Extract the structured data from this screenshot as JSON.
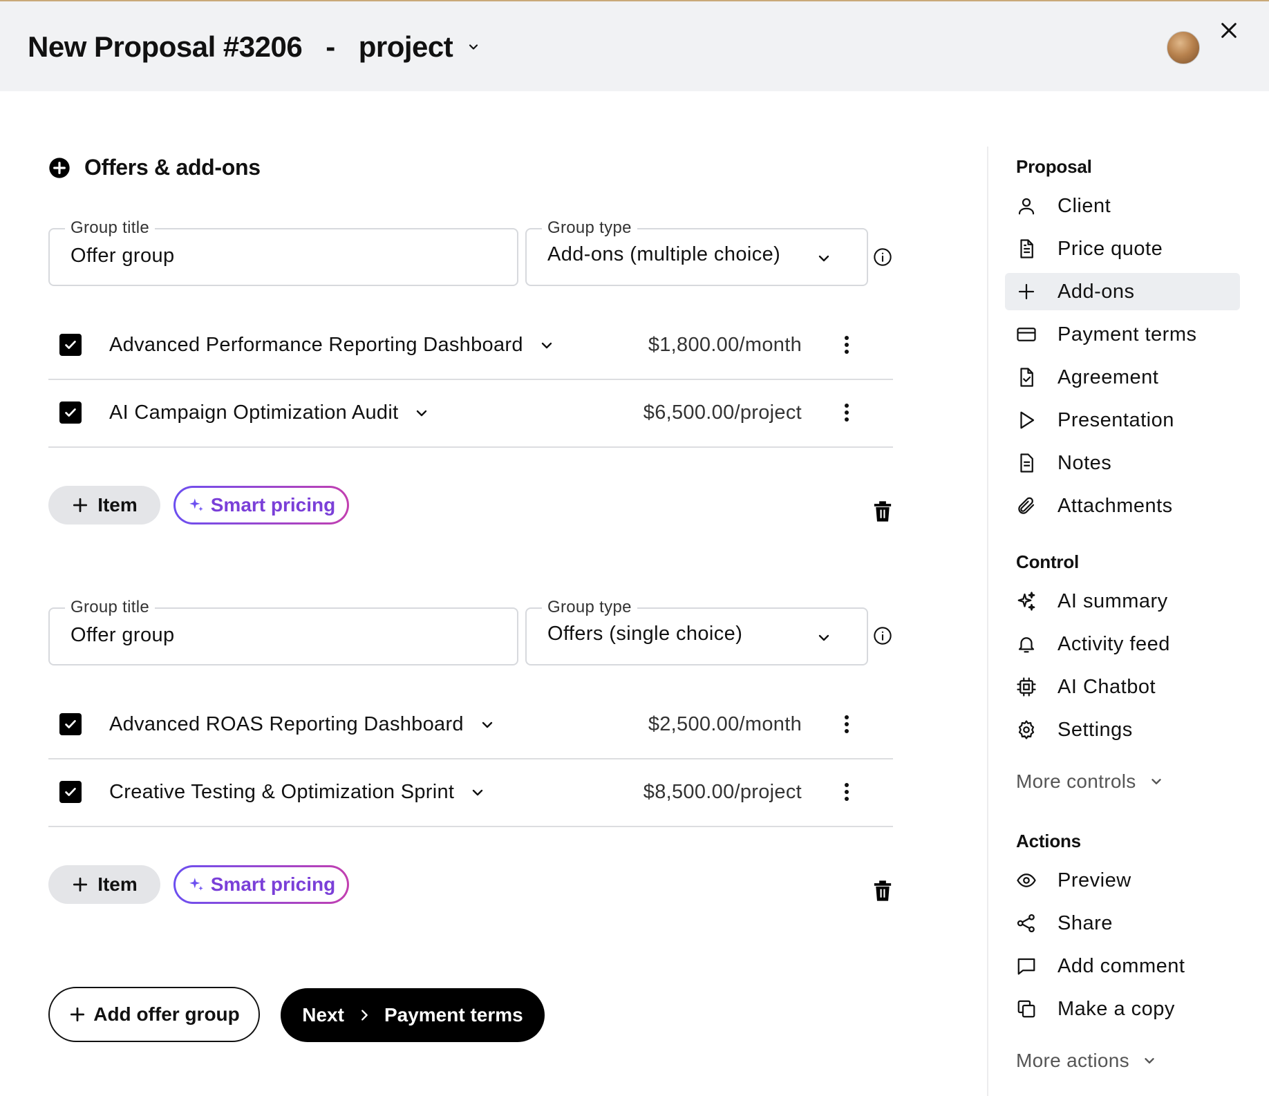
{
  "header": {
    "title": "New Proposal #3206",
    "separator": "-",
    "project": "project"
  },
  "main": {
    "section_title": "Offers & add-ons",
    "groups": [
      {
        "title_label": "Group title",
        "title_value": "Offer group",
        "type_label": "Group type",
        "type_value": "Add-ons (multiple choice)",
        "items": [
          {
            "name": "Advanced Performance Reporting Dashboard",
            "price": "$1,800.00/month",
            "checked": true
          },
          {
            "name": "AI Campaign Optimization Audit",
            "price": "$6,500.00/project",
            "checked": true
          }
        ],
        "item_button": "Item",
        "smart_pricing": "Smart pricing"
      },
      {
        "title_label": "Group title",
        "title_value": "Offer group",
        "type_label": "Group type",
        "type_value": "Offers (single choice)",
        "items": [
          {
            "name": "Advanced ROAS Reporting Dashboard",
            "price": "$2,500.00/month",
            "checked": true
          },
          {
            "name": "Creative Testing & Optimization Sprint",
            "price": "$8,500.00/project",
            "checked": true
          }
        ],
        "item_button": "Item",
        "smart_pricing": "Smart pricing"
      }
    ],
    "add_offer_group": "Add offer group",
    "next_label": "Next",
    "next_target": "Payment terms"
  },
  "sidebar": {
    "proposal_heading": "Proposal",
    "proposal_items": [
      {
        "label": "Client",
        "icon": "user-icon"
      },
      {
        "label": "Price quote",
        "icon": "document-icon"
      },
      {
        "label": "Add-ons",
        "icon": "plus-icon",
        "active": true
      },
      {
        "label": "Payment terms",
        "icon": "credit-card-icon"
      },
      {
        "label": "Agreement",
        "icon": "document-check-icon"
      },
      {
        "label": "Presentation",
        "icon": "play-icon"
      },
      {
        "label": "Notes",
        "icon": "notes-icon"
      },
      {
        "label": "Attachments",
        "icon": "paperclip-icon"
      }
    ],
    "control_heading": "Control",
    "control_items": [
      {
        "label": "AI summary",
        "icon": "sparkles-icon"
      },
      {
        "label": "Activity feed",
        "icon": "bell-icon"
      },
      {
        "label": "AI Chatbot",
        "icon": "chip-icon"
      },
      {
        "label": "Settings",
        "icon": "gear-icon"
      }
    ],
    "more_controls": "More controls",
    "actions_heading": "Actions",
    "action_items": [
      {
        "label": "Preview",
        "icon": "eye-icon"
      },
      {
        "label": "Share",
        "icon": "share-icon"
      },
      {
        "label": "Add comment",
        "icon": "comment-icon"
      },
      {
        "label": "Make a copy",
        "icon": "copy-icon"
      }
    ],
    "more_actions": "More actions"
  },
  "colors": {
    "header_bg": "#f1f2f4",
    "active_item_bg": "#eceef1",
    "smart_pricing_gradient_start": "#6c4ff0",
    "smart_pricing_gradient_end": "#c23fb0",
    "primary_button": "#000000"
  }
}
